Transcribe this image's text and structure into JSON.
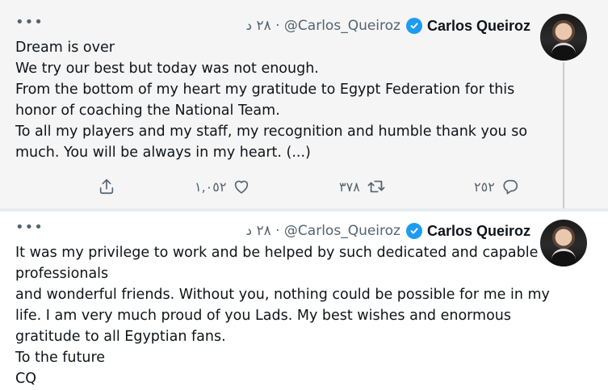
{
  "tweets": [
    {
      "more": "•••",
      "meta": "٢٨ د · @Carlos_Queiroz",
      "name": "Carlos Queiroz",
      "lines": [
        "Dream is over",
        "We try our best but today was not enough.",
        "From the bottom of my heart my gratitude to Egypt Federation for this",
        "honor of coaching the National Team.",
        "To all my players and my staff, my recognition and humble thank you so",
        "much. You will be always in my heart. (...)"
      ],
      "likes": "١,٠٥٢",
      "retweets": "٣٧٨",
      "replies": "٢٥٢"
    },
    {
      "more": "•••",
      "meta": "٢٨ د · @Carlos_Queiroz",
      "name": "Carlos Queiroz",
      "lines": [
        "It was my privilege to work and be helped by such dedicated and capable",
        "professionals",
        "and wonderful friends. Without you, nothing could be possible for me in my",
        "life. I am very much proud of you Lads. My best wishes and enormous",
        "gratitude to all Egyptian fans.",
        "To the future",
        "CQ"
      ]
    }
  ],
  "icons": {
    "share": "share-icon",
    "like": "heart-icon",
    "retweet": "retweet-icon",
    "reply": "reply-icon",
    "verified": "verified-badge-icon"
  },
  "colors": {
    "verified": "#1d9bf0",
    "muted": "#536471",
    "highlight_bg": "#f5f5f5"
  }
}
